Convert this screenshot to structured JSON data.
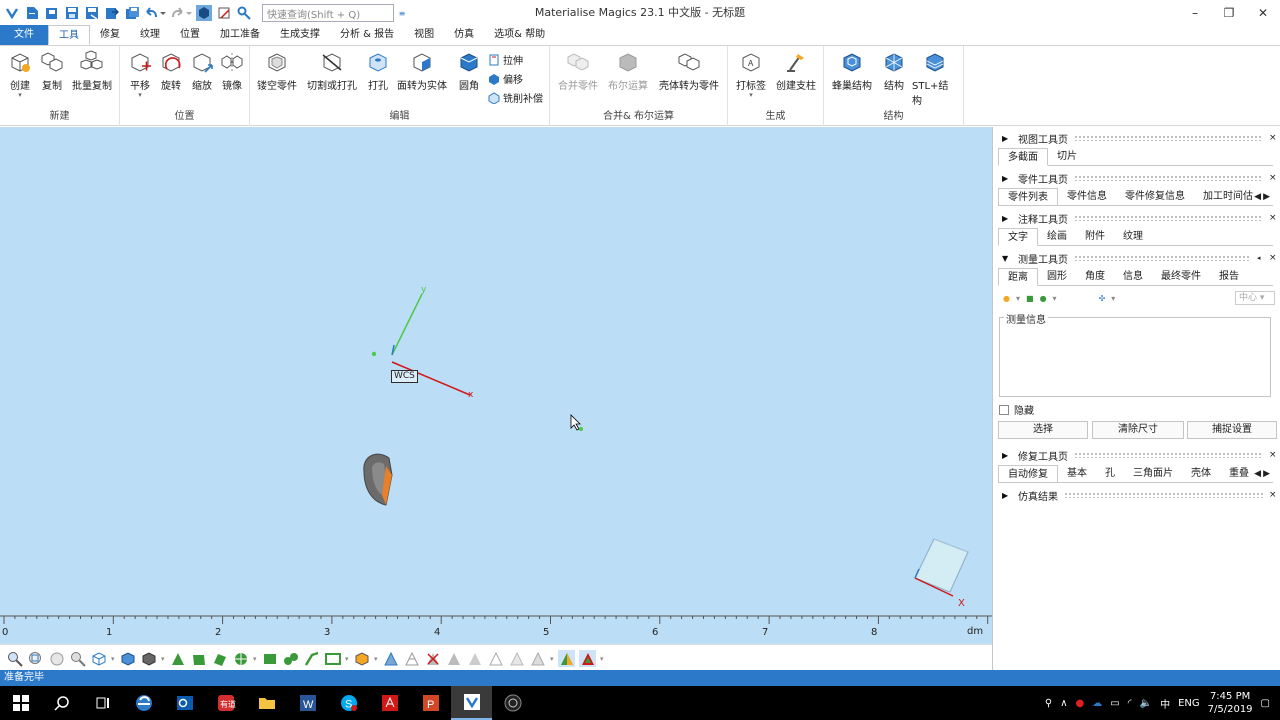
{
  "window": {
    "title": "Materialise Magics 23.1 中文版 - 无标题"
  },
  "quick_access": {
    "search_placeholder": "快速查询(Shift + Q)"
  },
  "ribbon_tabs": [
    {
      "label": "文件"
    },
    {
      "label": "工具"
    },
    {
      "label": "修复"
    },
    {
      "label": "纹理"
    },
    {
      "label": "位置"
    },
    {
      "label": "加工准备"
    },
    {
      "label": "生成支撑"
    },
    {
      "label": "分析 & 报告"
    },
    {
      "label": "视图"
    },
    {
      "label": "仿真"
    },
    {
      "label": "选项& 帮助"
    }
  ],
  "ribbon": {
    "new_group": {
      "name": "新建",
      "create": "创建",
      "copy": "复制",
      "batch_copy": "批量复制"
    },
    "position_group": {
      "name": "位置",
      "translate": "平移",
      "rotate": "旋转",
      "scale": "缩放",
      "mirror": "镜像"
    },
    "edit_group": {
      "name": "编辑",
      "hollow": "镂空零件",
      "cut_punch": "切割或打孔",
      "drill": "打孔",
      "face_to_solid": "面转为实体",
      "fillet": "圆角",
      "extrude": "拉伸",
      "offset": "偏移",
      "mill_compensate": "铣削补偿"
    },
    "merge_group": {
      "name": "合并& 布尔运算",
      "merge": "合并零件",
      "boolean": "布尔运算",
      "shell_to_part": "壳体转为零件"
    },
    "generate_group": {
      "name": "生成",
      "label": "打标签",
      "create_support": "创建支柱"
    },
    "structure_group": {
      "name": "结构",
      "honeycomb": "蜂巢结构",
      "structure": "结构",
      "stl_structure": "STL+结构"
    }
  },
  "viewport": {
    "wcs_label": "WCS",
    "axis_x": "x",
    "axis_y": "y",
    "corner_axis_x": "X",
    "ruler_ticks": [
      "0",
      "1",
      "2",
      "3",
      "4",
      "5",
      "6",
      "7",
      "8"
    ],
    "ruler_unit": "dm"
  },
  "panels": {
    "view_toolpage": {
      "title": "视图工具页",
      "tabs": [
        "多截面",
        "切片"
      ]
    },
    "part_toolpage": {
      "title": "零件工具页",
      "tabs": [
        "零件列表",
        "零件信息",
        "零件修复信息",
        "加工时间估"
      ]
    },
    "annotation_toolpage": {
      "title": "注释工具页",
      "tabs": [
        "文字",
        "绘画",
        "附件",
        "纹理"
      ]
    },
    "measure_toolpage": {
      "title": "测量工具页",
      "tabs": [
        "距离",
        "圆形",
        "角度",
        "信息",
        "最终零件",
        "报告"
      ],
      "snap_mode": "中心",
      "info_label": "测量信息",
      "hide_label": "隐藏",
      "select_button": "选择",
      "clear_button": "清除尺寸",
      "snap_button": "捕捉设置"
    },
    "repair_toolpage": {
      "title": "修复工具页",
      "tabs": [
        "自动修复",
        "基本",
        "孔",
        "三角面片",
        "壳体",
        "重叠"
      ]
    },
    "simulation_results": {
      "title": "仿真结果"
    }
  },
  "status": {
    "text": "准备完毕"
  },
  "taskbar": {
    "language": "ENG",
    "time": "7:45 PM",
    "date": "7/5/2019"
  },
  "colors": {
    "accent": "#2b79c8",
    "viewport_bg": "#bcddf6",
    "axis_x": "#d01818",
    "axis_y": "#4cc84c"
  }
}
